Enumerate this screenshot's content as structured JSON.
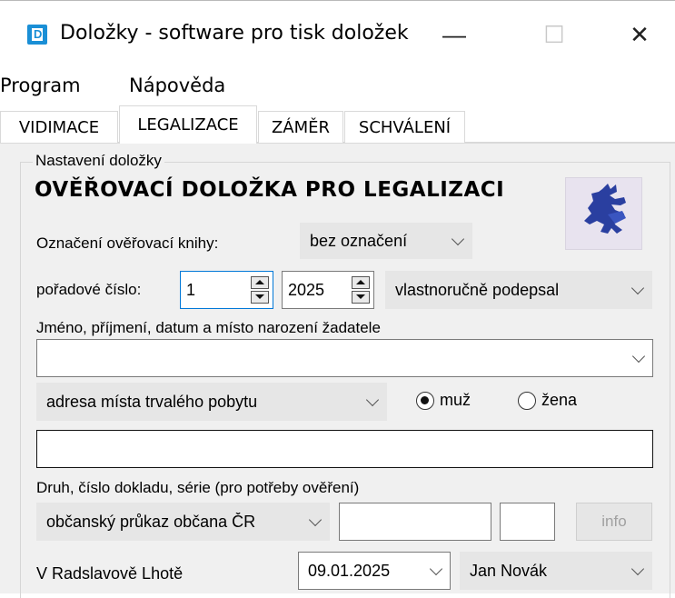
{
  "window": {
    "title": "Doložky - software pro tisk doložek",
    "app_icon_letter": "D",
    "minimize_glyph": "—",
    "maximize_glyph": "☐",
    "close_glyph": "✕"
  },
  "menu": [
    "Program",
    "Nápověda"
  ],
  "tabs": [
    {
      "label": "VIDIMACE",
      "active": false
    },
    {
      "label": "LEGALIZACE",
      "active": true
    },
    {
      "label": "ZÁMĚR",
      "active": false
    },
    {
      "label": "SCHVÁLENÍ",
      "active": false
    }
  ],
  "form": {
    "group_label": "Nastavení doložky",
    "heading": "OVĚŘOVACÍ DOLOŽKA PRO LEGALIZACI",
    "book_label": "Označení ověřovací knihy:",
    "book_value": "bez označení",
    "order_label": "pořadové číslo:",
    "order_number": "1",
    "year": "2025",
    "signature_type": "vlastnoručně podepsal",
    "applicant_label": "Jméno, příjmení, datum a místo narození žadatele",
    "applicant_value": "",
    "address_type": "adresa místa trvalého pobytu",
    "gender_male": "muž",
    "gender_female": "žena",
    "gender_selected": "muž",
    "address_value": "",
    "document_label": "Druh, číslo dokladu, série (pro potřeby ověření)",
    "document_type": "občanský průkaz občana ČR",
    "document_number": "",
    "document_series": "",
    "info_button": "info",
    "place": "V Radslavově Lhotě",
    "date": "09.01.2025",
    "officer": "Jan Novák"
  },
  "colors": {
    "accent": "#1a8fd6",
    "panel_bg": "#f0f0f0",
    "emblem_blue": "#2a3fa0"
  }
}
